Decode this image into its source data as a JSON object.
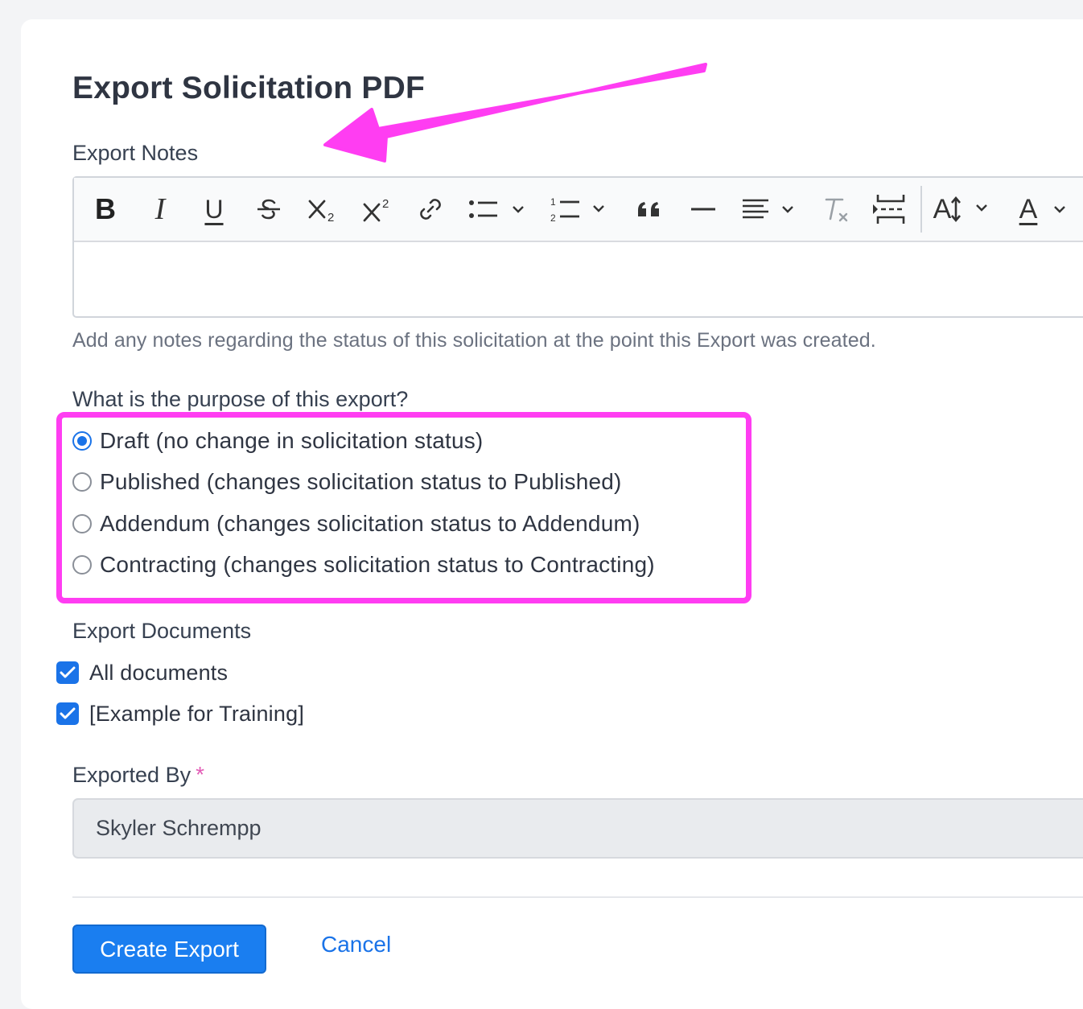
{
  "page": {
    "title": "Export Solicitation PDF"
  },
  "notes": {
    "label": "Export Notes",
    "help": "Add any notes regarding the status of this solicitation at the point this Export was created.",
    "value": "",
    "toolbar": [
      "bold-icon",
      "italic-icon",
      "underline-icon",
      "strikethrough-icon",
      "subscript-icon",
      "superscript-icon",
      "link-icon",
      "bulleted-list-icon",
      "numbered-list-icon",
      "blockquote-icon",
      "horizontal-line-icon",
      "align-left-icon",
      "clear-formatting-icon",
      "page-break-icon",
      "font-size-icon",
      "font-color-icon"
    ],
    "toolbar_glyphs": {
      "bold": "B",
      "italic": "I",
      "underline": "U",
      "font_size": "A",
      "font_color": "A"
    }
  },
  "purpose": {
    "label": "What is the purpose of this export?",
    "selected": 0,
    "options": [
      "Draft (no change in solicitation status)",
      "Published (changes solicitation status to Published)",
      "Addendum (changes solicitation status to Addendum)",
      "Contracting (changes solicitation status to Contracting)"
    ]
  },
  "documents": {
    "label": "Export Documents",
    "items": [
      {
        "label": "All documents",
        "checked": true
      },
      {
        "label": "[Example for Training]",
        "checked": true
      }
    ]
  },
  "exported_by": {
    "label": "Exported By",
    "required_mark": "*",
    "value": "Skyler Schrempp"
  },
  "actions": {
    "create_label": "Create Export",
    "cancel_label": "Cancel"
  },
  "colors": {
    "accent": "#1a73e8",
    "annotation": "#ff3df2"
  }
}
